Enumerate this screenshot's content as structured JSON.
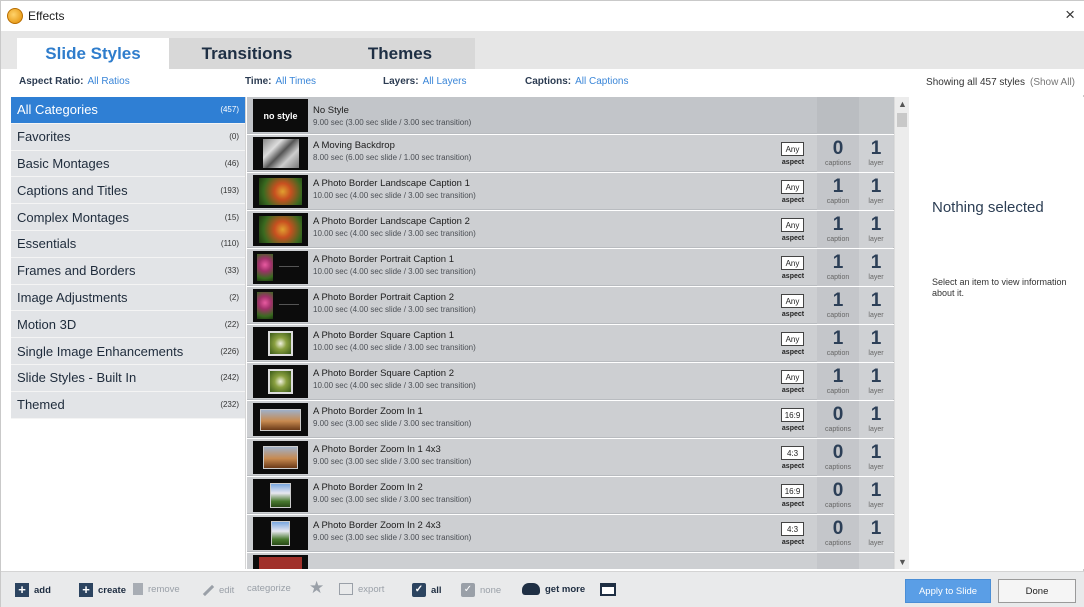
{
  "window": {
    "title": "Effects",
    "close_glyph": "×"
  },
  "tabs": [
    {
      "label": "Slide Styles",
      "active": true
    },
    {
      "label": "Transitions",
      "active": false
    },
    {
      "label": "Themes",
      "active": false
    }
  ],
  "filters": {
    "aspect": {
      "label": "Aspect Ratio:",
      "value": "All Ratios"
    },
    "time": {
      "label": "Time:",
      "value": "All Times"
    },
    "layers": {
      "label": "Layers:",
      "value": "All Layers"
    },
    "captions": {
      "label": "Captions:",
      "value": "All Captions"
    },
    "showing": "Showing all 457 styles",
    "show_all": "(Show All)"
  },
  "categories": [
    {
      "label": "All Categories",
      "count": "(457)",
      "selected": true
    },
    {
      "label": "Favorites",
      "count": "(0)"
    },
    {
      "label": "Basic Montages",
      "count": "(46)"
    },
    {
      "label": "Captions and Titles",
      "count": "(193)"
    },
    {
      "label": "Complex Montages",
      "count": "(15)"
    },
    {
      "label": "Essentials",
      "count": "(110)"
    },
    {
      "label": "Frames and Borders",
      "count": "(33)"
    },
    {
      "label": "Image Adjustments",
      "count": "(2)"
    },
    {
      "label": "Motion 3D",
      "count": "(22)"
    },
    {
      "label": "Single Image Enhancements",
      "count": "(226)"
    },
    {
      "label": "Slide Styles - Built In",
      "count": "(242)"
    },
    {
      "label": "Themed",
      "count": "(232)"
    }
  ],
  "styles": [
    {
      "name": "No Style",
      "sub": "9.00 sec (3.00 sec slide / 3.00 sec transition)",
      "thumb_text": "no style",
      "aspect": "",
      "aspect_label": "",
      "captions": "",
      "captions_label": "",
      "layers": "",
      "layers_label": ""
    },
    {
      "name": "A Moving Backdrop",
      "sub": "8.00 sec (6.00 sec slide / 1.00 sec transition)",
      "aspect": "Any",
      "aspect_label": "aspect",
      "captions": "0",
      "captions_label": "captions",
      "layers": "1",
      "layers_label": "layer"
    },
    {
      "name": "A Photo Border Landscape Caption 1",
      "sub": "10.00 sec (4.00 sec slide / 3.00 sec transition)",
      "aspect": "Any",
      "aspect_label": "aspect",
      "captions": "1",
      "captions_label": "caption",
      "layers": "1",
      "layers_label": "layer"
    },
    {
      "name": "A Photo Border Landscape Caption 2",
      "sub": "10.00 sec (4.00 sec slide / 3.00 sec transition)",
      "aspect": "Any",
      "aspect_label": "aspect",
      "captions": "1",
      "captions_label": "caption",
      "layers": "1",
      "layers_label": "layer"
    },
    {
      "name": "A Photo Border Portrait Caption 1",
      "sub": "10.00 sec (4.00 sec slide / 3.00 sec transition)",
      "aspect": "Any",
      "aspect_label": "aspect",
      "captions": "1",
      "captions_label": "caption",
      "layers": "1",
      "layers_label": "layer"
    },
    {
      "name": "A Photo Border Portrait Caption 2",
      "sub": "10.00 sec (4.00 sec slide / 3.00 sec transition)",
      "aspect": "Any",
      "aspect_label": "aspect",
      "captions": "1",
      "captions_label": "caption",
      "layers": "1",
      "layers_label": "layer"
    },
    {
      "name": "A Photo Border Square Caption 1",
      "sub": "10.00 sec (4.00 sec slide / 3.00 sec transition)",
      "aspect": "Any",
      "aspect_label": "aspect",
      "captions": "1",
      "captions_label": "caption",
      "layers": "1",
      "layers_label": "layer"
    },
    {
      "name": "A Photo Border Square Caption 2",
      "sub": "10.00 sec (4.00 sec slide / 3.00 sec transition)",
      "aspect": "Any",
      "aspect_label": "aspect",
      "captions": "1",
      "captions_label": "caption",
      "layers": "1",
      "layers_label": "layer"
    },
    {
      "name": "A Photo Border Zoom In 1",
      "sub": "9.00 sec (3.00 sec slide / 3.00 sec transition)",
      "aspect": "16:9",
      "aspect_label": "aspect",
      "captions": "0",
      "captions_label": "captions",
      "layers": "1",
      "layers_label": "layer"
    },
    {
      "name": "A Photo Border Zoom In 1 4x3",
      "sub": "9.00 sec (3.00 sec slide / 3.00 sec transition)",
      "aspect": "4:3",
      "aspect_label": "aspect",
      "captions": "0",
      "captions_label": "captions",
      "layers": "1",
      "layers_label": "layer"
    },
    {
      "name": "A Photo Border Zoom In 2",
      "sub": "9.00 sec (3.00 sec slide / 3.00 sec transition)",
      "aspect": "16:9",
      "aspect_label": "aspect",
      "captions": "0",
      "captions_label": "captions",
      "layers": "1",
      "layers_label": "layer"
    },
    {
      "name": "A Photo Border Zoom In 2 4x3",
      "sub": "9.00 sec (3.00 sec slide / 3.00 sec transition)",
      "aspect": "4:3",
      "aspect_label": "aspect",
      "captions": "0",
      "captions_label": "captions",
      "layers": "1",
      "layers_label": "layer"
    }
  ],
  "info": {
    "title": "Nothing selected",
    "sub": "Select an item to view information about it."
  },
  "toolbar": {
    "add": "add",
    "create": "create",
    "remove": "remove",
    "edit": "edit",
    "categorize": "categorize",
    "export": "export",
    "all": "all",
    "none": "none",
    "get_more": "get more",
    "apply": "Apply to Slide",
    "done": "Done"
  },
  "colors": {
    "accent": "#2f7fd4",
    "tab_active_text": "#2f7dcc",
    "apply_button": "#5a9ee6"
  }
}
